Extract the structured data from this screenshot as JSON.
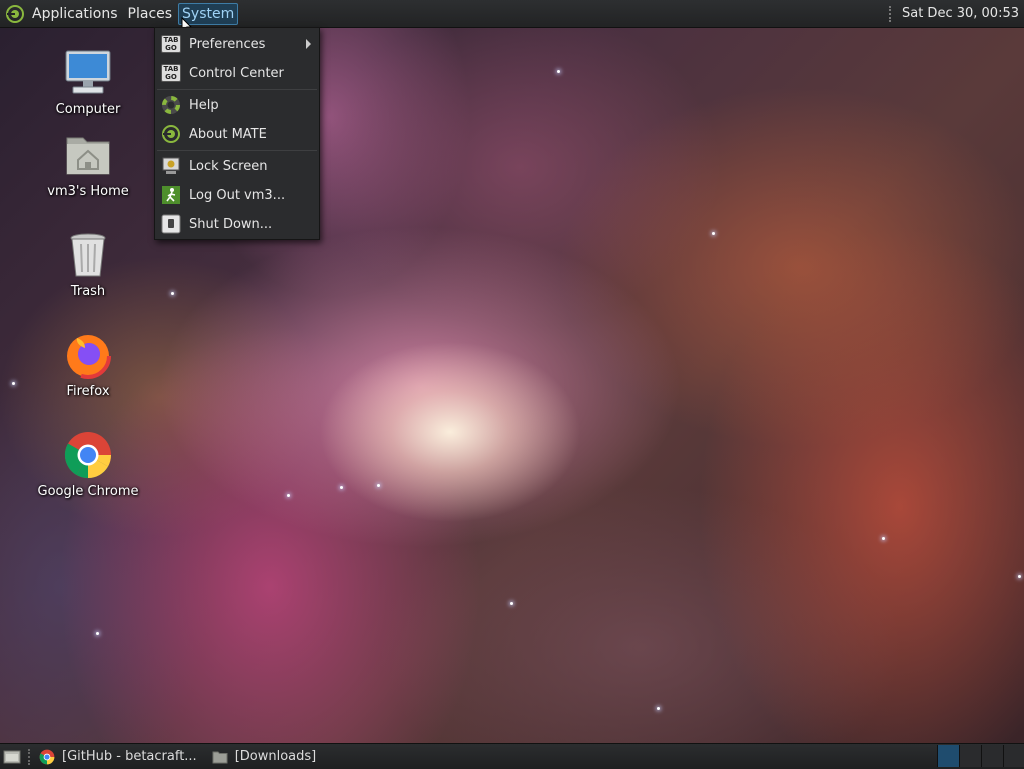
{
  "top_panel": {
    "menus": [
      "Applications",
      "Places",
      "System"
    ],
    "active_menu": "System",
    "clock": "Sat Dec 30, 00:53"
  },
  "system_menu": {
    "items": [
      {
        "label": "Preferences",
        "icon": "preferences-icon",
        "submenu": true
      },
      {
        "label": "Control Center",
        "icon": "control-center-icon"
      },
      {
        "label": "Help",
        "icon": "help-icon"
      },
      {
        "label": "About MATE",
        "icon": "mate-logo-icon"
      },
      {
        "label": "Lock Screen",
        "icon": "lock-screen-icon"
      },
      {
        "label": "Log Out vm3...",
        "icon": "log-out-icon"
      },
      {
        "label": "Shut Down...",
        "icon": "shutdown-icon"
      }
    ]
  },
  "desktop": {
    "icons": [
      {
        "label": "Computer",
        "icon": "computer-icon"
      },
      {
        "label": "vm3's Home",
        "icon": "home-folder-icon"
      },
      {
        "label": "Trash",
        "icon": "trash-icon"
      },
      {
        "label": "Firefox",
        "icon": "firefox-icon"
      },
      {
        "label": "Google Chrome",
        "icon": "chrome-icon"
      }
    ]
  },
  "taskbar": {
    "tasks": [
      {
        "label": "[GitHub - betacraft...",
        "icon": "chrome-icon"
      },
      {
        "label": "[Downloads]",
        "icon": "folder-icon"
      }
    ]
  },
  "colors": {
    "panel_bg": "#232425",
    "active_menu_bg": "#1f3e54",
    "active_menu_border": "#3e7ca6",
    "menu_bg": "#2b2c2e",
    "mate_green": "#8ab83e"
  }
}
